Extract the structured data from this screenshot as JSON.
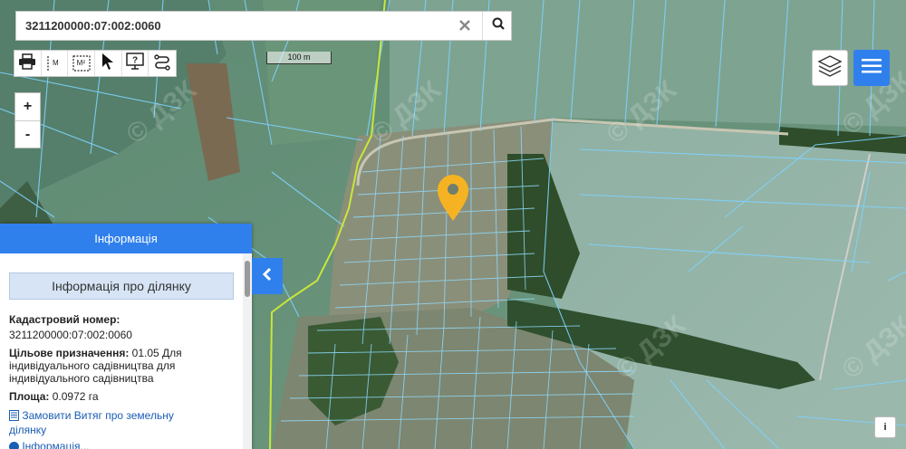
{
  "search": {
    "value": "3211200000:07:002:0060",
    "clear_icon": "close-icon",
    "search_icon": "search-icon"
  },
  "toolbar": {
    "tools": [
      "print-icon",
      "measure-length-icon",
      "measure-area-icon",
      "pointer-icon",
      "help-icon",
      "route-icon"
    ],
    "measure_length_label": "M",
    "measure_area_label": "M²"
  },
  "zoom": {
    "in_label": "+",
    "out_label": "-"
  },
  "scale": {
    "label": "100 m"
  },
  "watermark": "© ДЗК",
  "colors": {
    "accent": "#2f80ed",
    "parcel_lines": "#7fd3ff",
    "boundary": "#c8e63a",
    "marker": "#f5b324"
  },
  "info": {
    "header": "Інформація",
    "subheader": "Інформація про ділянку",
    "cadastral_label": "Кадастровий номер:",
    "cadastral_value": "3211200000:07:002:0060",
    "purpose_label": "Цільове призначення:",
    "purpose_value_1": " 01.05 Для",
    "purpose_value_2": "індивідуального садівництва для",
    "purpose_value_3": "індивідуального садівництва",
    "area_label": "Площа:",
    "area_value": " 0.0972 га",
    "order_link_1": "Замовити Витяг про земельну",
    "order_link_2": "ділянку",
    "more_partial": "Інформація..."
  },
  "about_label": "i"
}
